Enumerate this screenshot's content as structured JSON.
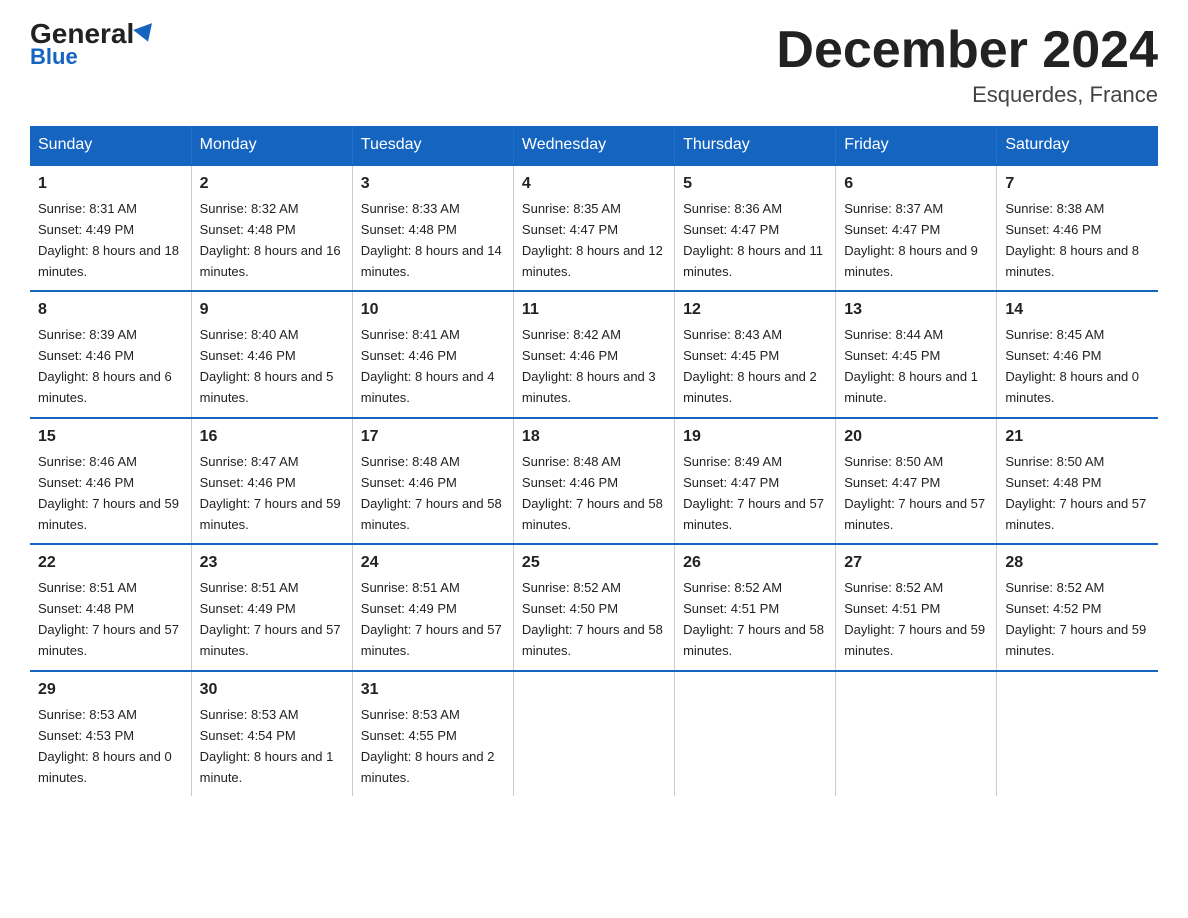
{
  "header": {
    "logo_general": "General",
    "logo_blue": "Blue",
    "month_title": "December 2024",
    "location": "Esquerdes, France"
  },
  "days_of_week": [
    "Sunday",
    "Monday",
    "Tuesday",
    "Wednesday",
    "Thursday",
    "Friday",
    "Saturday"
  ],
  "weeks": [
    [
      {
        "day": "1",
        "sunrise": "8:31 AM",
        "sunset": "4:49 PM",
        "daylight": "8 hours and 18 minutes."
      },
      {
        "day": "2",
        "sunrise": "8:32 AM",
        "sunset": "4:48 PM",
        "daylight": "8 hours and 16 minutes."
      },
      {
        "day": "3",
        "sunrise": "8:33 AM",
        "sunset": "4:48 PM",
        "daylight": "8 hours and 14 minutes."
      },
      {
        "day": "4",
        "sunrise": "8:35 AM",
        "sunset": "4:47 PM",
        "daylight": "8 hours and 12 minutes."
      },
      {
        "day": "5",
        "sunrise": "8:36 AM",
        "sunset": "4:47 PM",
        "daylight": "8 hours and 11 minutes."
      },
      {
        "day": "6",
        "sunrise": "8:37 AM",
        "sunset": "4:47 PM",
        "daylight": "8 hours and 9 minutes."
      },
      {
        "day": "7",
        "sunrise": "8:38 AM",
        "sunset": "4:46 PM",
        "daylight": "8 hours and 8 minutes."
      }
    ],
    [
      {
        "day": "8",
        "sunrise": "8:39 AM",
        "sunset": "4:46 PM",
        "daylight": "8 hours and 6 minutes."
      },
      {
        "day": "9",
        "sunrise": "8:40 AM",
        "sunset": "4:46 PM",
        "daylight": "8 hours and 5 minutes."
      },
      {
        "day": "10",
        "sunrise": "8:41 AM",
        "sunset": "4:46 PM",
        "daylight": "8 hours and 4 minutes."
      },
      {
        "day": "11",
        "sunrise": "8:42 AM",
        "sunset": "4:46 PM",
        "daylight": "8 hours and 3 minutes."
      },
      {
        "day": "12",
        "sunrise": "8:43 AM",
        "sunset": "4:45 PM",
        "daylight": "8 hours and 2 minutes."
      },
      {
        "day": "13",
        "sunrise": "8:44 AM",
        "sunset": "4:45 PM",
        "daylight": "8 hours and 1 minute."
      },
      {
        "day": "14",
        "sunrise": "8:45 AM",
        "sunset": "4:46 PM",
        "daylight": "8 hours and 0 minutes."
      }
    ],
    [
      {
        "day": "15",
        "sunrise": "8:46 AM",
        "sunset": "4:46 PM",
        "daylight": "7 hours and 59 minutes."
      },
      {
        "day": "16",
        "sunrise": "8:47 AM",
        "sunset": "4:46 PM",
        "daylight": "7 hours and 59 minutes."
      },
      {
        "day": "17",
        "sunrise": "8:48 AM",
        "sunset": "4:46 PM",
        "daylight": "7 hours and 58 minutes."
      },
      {
        "day": "18",
        "sunrise": "8:48 AM",
        "sunset": "4:46 PM",
        "daylight": "7 hours and 58 minutes."
      },
      {
        "day": "19",
        "sunrise": "8:49 AM",
        "sunset": "4:47 PM",
        "daylight": "7 hours and 57 minutes."
      },
      {
        "day": "20",
        "sunrise": "8:50 AM",
        "sunset": "4:47 PM",
        "daylight": "7 hours and 57 minutes."
      },
      {
        "day": "21",
        "sunrise": "8:50 AM",
        "sunset": "4:48 PM",
        "daylight": "7 hours and 57 minutes."
      }
    ],
    [
      {
        "day": "22",
        "sunrise": "8:51 AM",
        "sunset": "4:48 PM",
        "daylight": "7 hours and 57 minutes."
      },
      {
        "day": "23",
        "sunrise": "8:51 AM",
        "sunset": "4:49 PM",
        "daylight": "7 hours and 57 minutes."
      },
      {
        "day": "24",
        "sunrise": "8:51 AM",
        "sunset": "4:49 PM",
        "daylight": "7 hours and 57 minutes."
      },
      {
        "day": "25",
        "sunrise": "8:52 AM",
        "sunset": "4:50 PM",
        "daylight": "7 hours and 58 minutes."
      },
      {
        "day": "26",
        "sunrise": "8:52 AM",
        "sunset": "4:51 PM",
        "daylight": "7 hours and 58 minutes."
      },
      {
        "day": "27",
        "sunrise": "8:52 AM",
        "sunset": "4:51 PM",
        "daylight": "7 hours and 59 minutes."
      },
      {
        "day": "28",
        "sunrise": "8:52 AM",
        "sunset": "4:52 PM",
        "daylight": "7 hours and 59 minutes."
      }
    ],
    [
      {
        "day": "29",
        "sunrise": "8:53 AM",
        "sunset": "4:53 PM",
        "daylight": "8 hours and 0 minutes."
      },
      {
        "day": "30",
        "sunrise": "8:53 AM",
        "sunset": "4:54 PM",
        "daylight": "8 hours and 1 minute."
      },
      {
        "day": "31",
        "sunrise": "8:53 AM",
        "sunset": "4:55 PM",
        "daylight": "8 hours and 2 minutes."
      },
      null,
      null,
      null,
      null
    ]
  ]
}
